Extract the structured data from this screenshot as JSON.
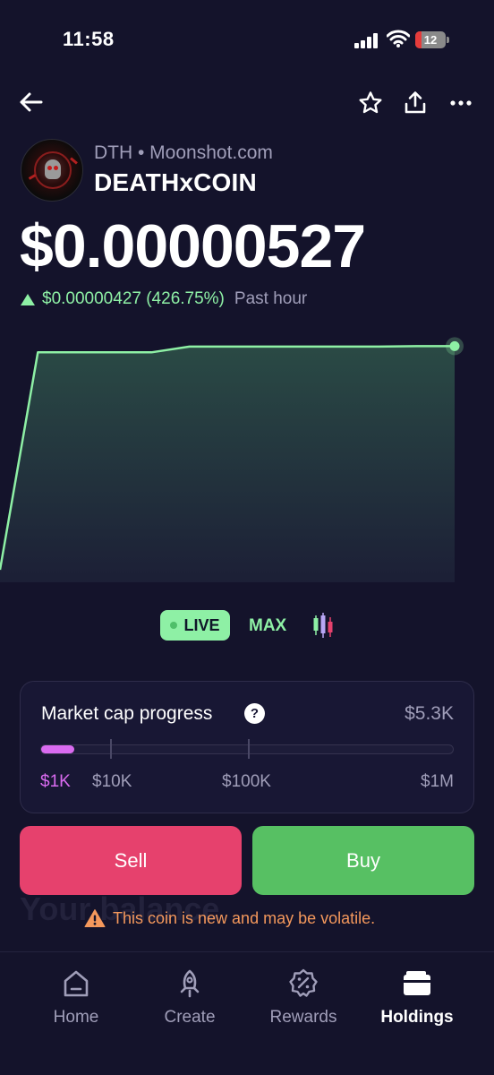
{
  "status_bar": {
    "time": "11:58",
    "battery_level": "12"
  },
  "coin": {
    "meta": "DTH • Moonshot.com",
    "name": "DEATHxCOIN",
    "price": "$0.00000527",
    "change": "$0.00000427 (426.75%)",
    "change_period": "Past hour"
  },
  "chart_data": {
    "type": "area",
    "series": [
      {
        "values": [
          0.6,
          5.15,
          5.15,
          5.15,
          5.15,
          5.27,
          5.27,
          5.27,
          5.27,
          5.27,
          5.27,
          5.28,
          5.28
        ]
      }
    ],
    "ylim": [
      0.6,
      5.4
    ],
    "line_color": "#8ef0a5",
    "fill_color": "#2a4a45",
    "grid": false
  },
  "range_selector": {
    "live_label": "LIVE",
    "max_label": "MAX",
    "candle_icon": "candlestick-icon"
  },
  "market_cap": {
    "title": "Market cap progress",
    "help_symbol": "?",
    "value": "$5.3K",
    "progress_fraction": 0.08,
    "labels": [
      "$1K",
      "$10K",
      "$100K",
      "$1M"
    ]
  },
  "actions": {
    "sell_label": "Sell",
    "buy_label": "Buy"
  },
  "background_text": "Your balance",
  "warning": "This coin is new and may be volatile.",
  "tabs": [
    {
      "label": "Home",
      "icon": "home-icon"
    },
    {
      "label": "Create",
      "icon": "rocket-icon"
    },
    {
      "label": "Rewards",
      "icon": "rewards-badge-icon"
    },
    {
      "label": "Holdings",
      "icon": "wallet-icon",
      "active": true
    }
  ],
  "colors": {
    "accent_green": "#8ef0a5",
    "sell": "#e6416d",
    "buy": "#57c063",
    "progress": "#d96bf0",
    "warning": "#f4985c"
  }
}
